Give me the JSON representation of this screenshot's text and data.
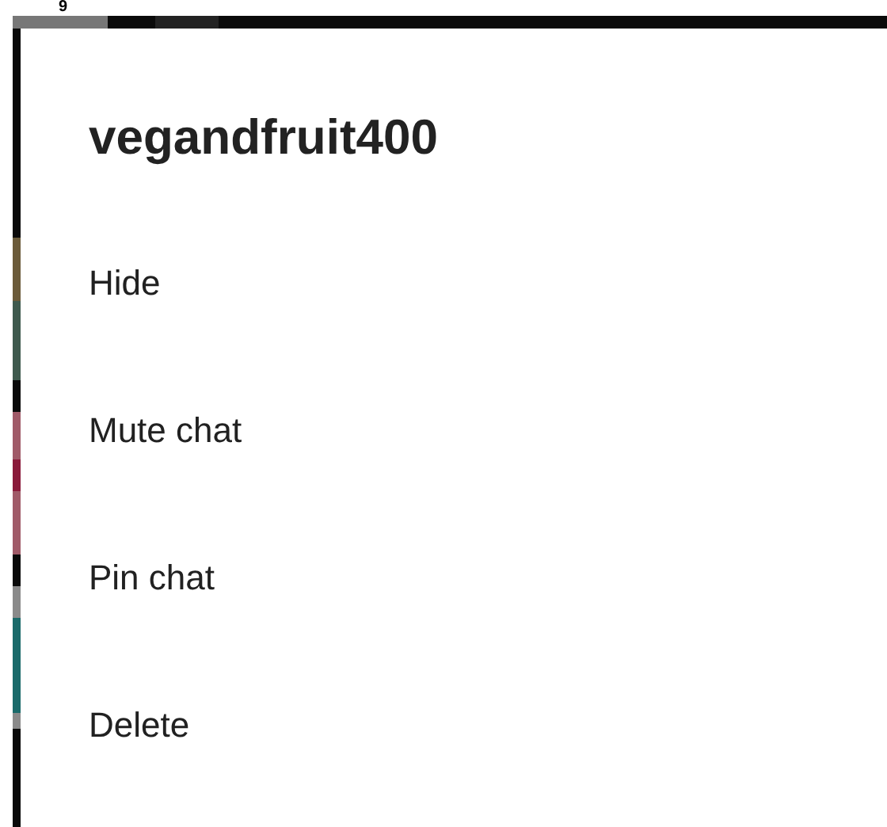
{
  "status_fragment": "9",
  "dialog": {
    "title": "vegandfruit400",
    "items": [
      {
        "label": "Hide"
      },
      {
        "label": "Mute chat"
      },
      {
        "label": "Pin chat"
      },
      {
        "label": "Delete"
      }
    ]
  }
}
